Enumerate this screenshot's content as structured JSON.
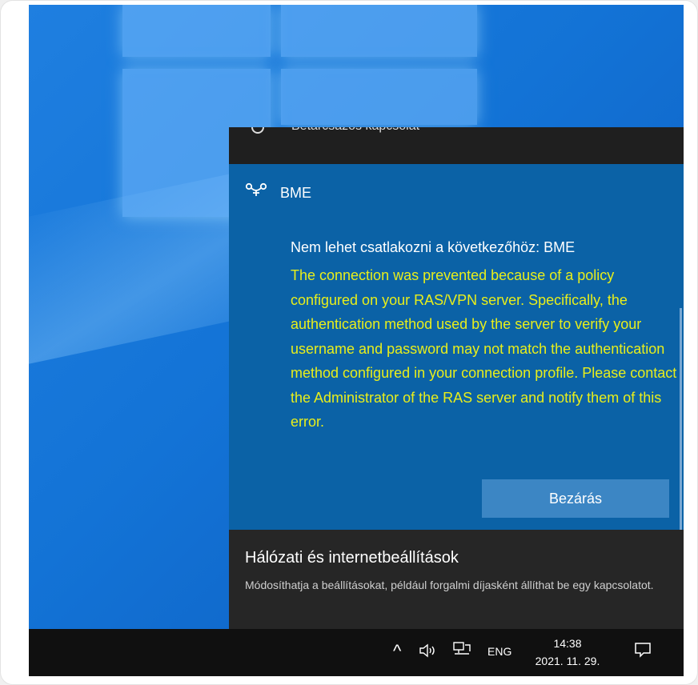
{
  "flyout": {
    "cut_item_text": "Betárcsázós kapcsolat",
    "vpn": {
      "name": "BME",
      "icon": "vpn-link-icon",
      "error_title": "Nem lehet csatlakozni a következőhöz: BME",
      "error_message": "The connection was prevented because of a policy configured on your RAS/VPN server. Specifically, the authentication method used by the server to verify your username and password may not match the authentication method configured in your connection profile. Please contact the Administrator of the RAS server and notify them of this error.",
      "close_label": "Bezárás"
    },
    "settings": {
      "title": "Hálózati és internetbeállítások",
      "description": "Módosíthatja a beállításokat, például forgalmi díjasként állíthat be egy kapcsolatot."
    }
  },
  "taskbar": {
    "chevron": "^",
    "language": "ENG",
    "time": "14:38",
    "date": "2021. 11. 29."
  },
  "colors": {
    "vpn_panel": "#0b62a6",
    "error_text": "#e8ee1b",
    "button": "#3c86c4",
    "flyout_bg": "#1f1f1f",
    "taskbar_bg": "#101010"
  }
}
